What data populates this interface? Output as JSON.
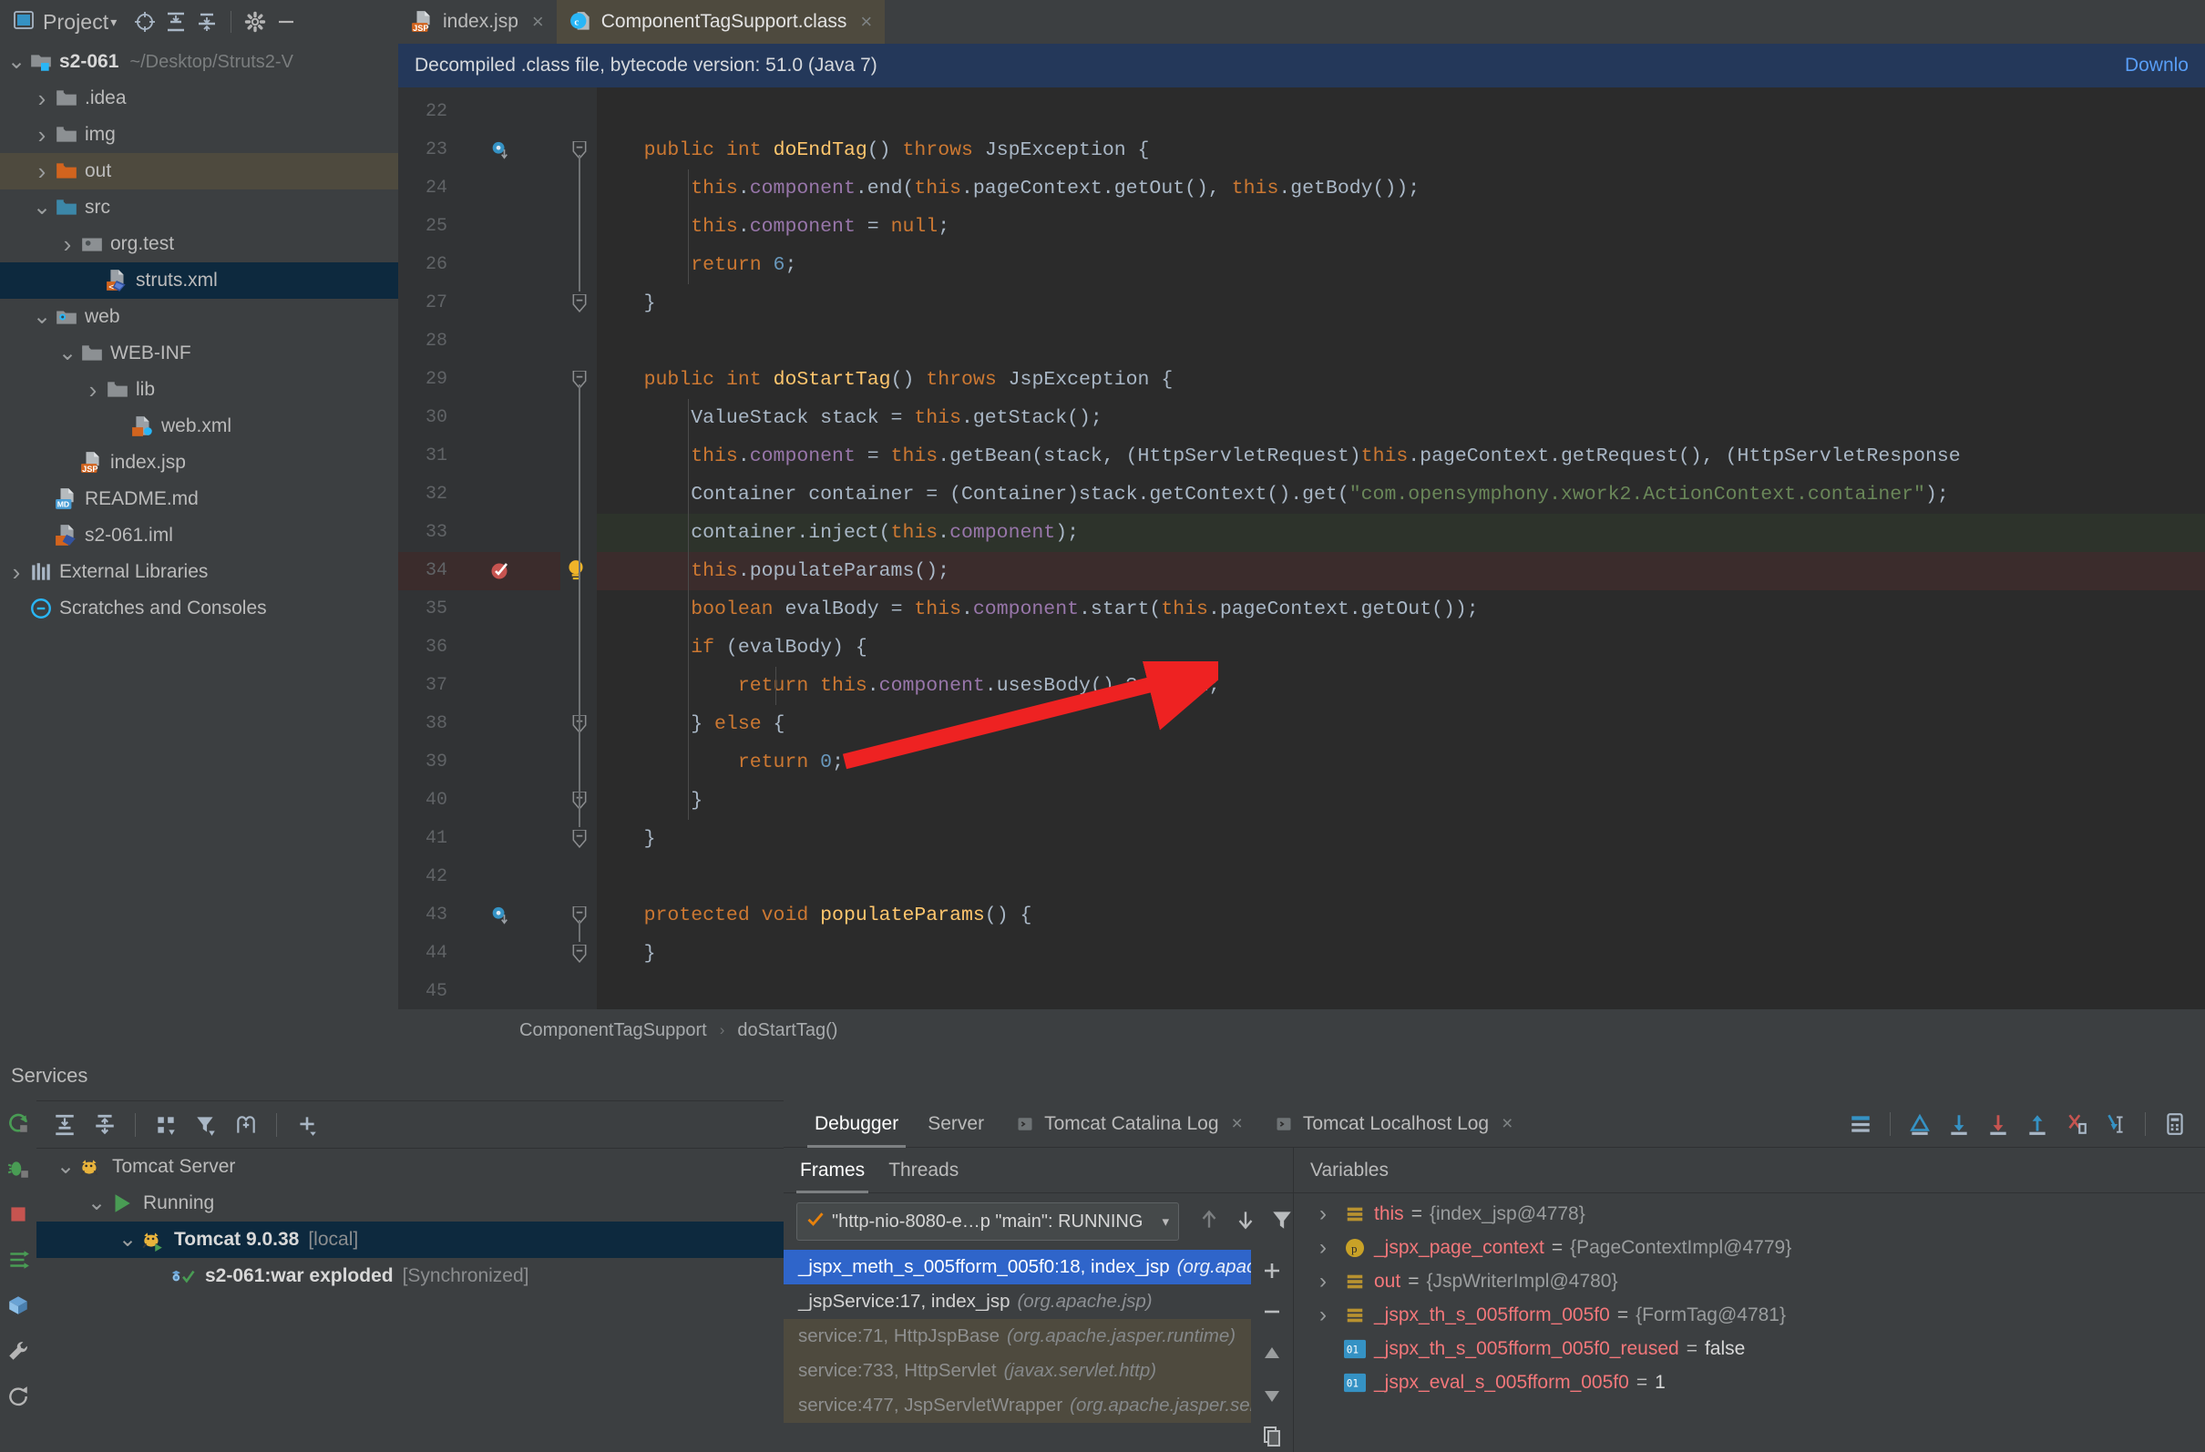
{
  "project_panel": {
    "title": "Project",
    "icons": [
      "project-view-icon",
      "locate-icon",
      "expand-all-icon",
      "collapse-all-icon",
      "settings-gear-icon",
      "hide-icon"
    ],
    "tree": [
      {
        "label": "s2-061",
        "path": "~/Desktop/Struts2-V",
        "icon": "module-folder-icon",
        "twisty": "v",
        "indent": 0,
        "bold": true,
        "state": "normal"
      },
      {
        "label": ".idea",
        "path": "",
        "icon": "folder-icon",
        "twisty": ">",
        "indent": 1,
        "bold": false,
        "state": "normal"
      },
      {
        "label": "img",
        "path": "",
        "icon": "folder-icon",
        "twisty": ">",
        "indent": 1,
        "bold": false,
        "state": "normal"
      },
      {
        "label": "out",
        "path": "",
        "icon": "folder-orange-icon",
        "twisty": ">",
        "indent": 1,
        "bold": false,
        "state": "brown"
      },
      {
        "label": "src",
        "path": "",
        "icon": "folder-blue-icon",
        "twisty": "v",
        "indent": 1,
        "bold": false,
        "state": "normal"
      },
      {
        "label": "org.test",
        "path": "",
        "icon": "package-icon",
        "twisty": ">",
        "indent": 2,
        "bold": false,
        "state": "normal"
      },
      {
        "label": "struts.xml",
        "path": "",
        "icon": "struts-xml-icon",
        "twisty": "",
        "indent": 3,
        "bold": false,
        "state": "blue"
      },
      {
        "label": "web",
        "path": "",
        "icon": "web-folder-icon",
        "twisty": "v",
        "indent": 1,
        "bold": false,
        "state": "normal"
      },
      {
        "label": "WEB-INF",
        "path": "",
        "icon": "folder-icon",
        "twisty": "v",
        "indent": 2,
        "bold": false,
        "state": "normal"
      },
      {
        "label": "lib",
        "path": "",
        "icon": "folder-icon",
        "twisty": ">",
        "indent": 3,
        "bold": false,
        "state": "normal"
      },
      {
        "label": "web.xml",
        "path": "",
        "icon": "web-xml-icon",
        "twisty": "",
        "indent": 4,
        "bold": false,
        "state": "normal"
      },
      {
        "label": "index.jsp",
        "path": "",
        "icon": "jsp-file-icon",
        "twisty": "",
        "indent": 2,
        "bold": false,
        "state": "normal"
      },
      {
        "label": "README.md",
        "path": "",
        "icon": "markdown-icon",
        "twisty": "",
        "indent": 1,
        "bold": false,
        "state": "normal"
      },
      {
        "label": "s2-061.iml",
        "path": "",
        "icon": "iml-file-icon",
        "twisty": "",
        "indent": 1,
        "bold": false,
        "state": "normal"
      },
      {
        "label": "External Libraries",
        "path": "",
        "icon": "libraries-icon",
        "twisty": ">",
        "indent": 0,
        "bold": false,
        "state": "normal"
      },
      {
        "label": "Scratches and Consoles",
        "path": "",
        "icon": "scratches-icon",
        "twisty": "",
        "indent": 0,
        "bold": false,
        "state": "normal"
      }
    ]
  },
  "editor_tabs": [
    {
      "label": "index.jsp",
      "icon": "jsp-file-icon",
      "active": false
    },
    {
      "label": "ComponentTagSupport.class",
      "icon": "class-file-icon",
      "active": true
    }
  ],
  "notification": {
    "message": "Decompiled .class file, bytecode version: 51.0 (Java 7)",
    "action": "Downlo"
  },
  "editor": {
    "first_line": 22,
    "last_line": 45,
    "highlight_line": 34,
    "lines": [
      {
        "n": 22,
        "tokens": []
      },
      {
        "n": 23,
        "tokens": [
          {
            "t": "    ",
            "c": "pln"
          },
          {
            "t": "public",
            "c": "kw"
          },
          {
            "t": " ",
            "c": "pln"
          },
          {
            "t": "int",
            "c": "kw"
          },
          {
            "t": " ",
            "c": "pln"
          },
          {
            "t": "doEndTag",
            "c": "met"
          },
          {
            "t": "() ",
            "c": "pln"
          },
          {
            "t": "throws",
            "c": "kw"
          },
          {
            "t": " JspException {",
            "c": "pln"
          }
        ]
      },
      {
        "n": 24,
        "tokens": [
          {
            "t": "        ",
            "c": "pln"
          },
          {
            "t": "this",
            "c": "kw"
          },
          {
            "t": ".",
            "c": "pln"
          },
          {
            "t": "component",
            "c": "fld"
          },
          {
            "t": ".end(",
            "c": "pln"
          },
          {
            "t": "this",
            "c": "kw"
          },
          {
            "t": ".pageContext.getOut(), ",
            "c": "pln"
          },
          {
            "t": "this",
            "c": "kw"
          },
          {
            "t": ".getBody());",
            "c": "pln"
          }
        ]
      },
      {
        "n": 25,
        "tokens": [
          {
            "t": "        ",
            "c": "pln"
          },
          {
            "t": "this",
            "c": "kw"
          },
          {
            "t": ".",
            "c": "pln"
          },
          {
            "t": "component",
            "c": "fld"
          },
          {
            "t": " = ",
            "c": "pln"
          },
          {
            "t": "null",
            "c": "kw"
          },
          {
            "t": ";",
            "c": "pln"
          }
        ]
      },
      {
        "n": 26,
        "tokens": [
          {
            "t": "        ",
            "c": "pln"
          },
          {
            "t": "return",
            "c": "kw"
          },
          {
            "t": " ",
            "c": "pln"
          },
          {
            "t": "6",
            "c": "num"
          },
          {
            "t": ";",
            "c": "pln"
          }
        ]
      },
      {
        "n": 27,
        "tokens": [
          {
            "t": "    }",
            "c": "pln"
          }
        ]
      },
      {
        "n": 28,
        "tokens": []
      },
      {
        "n": 29,
        "tokens": [
          {
            "t": "    ",
            "c": "pln"
          },
          {
            "t": "public",
            "c": "kw"
          },
          {
            "t": " ",
            "c": "pln"
          },
          {
            "t": "int",
            "c": "kw"
          },
          {
            "t": " ",
            "c": "pln"
          },
          {
            "t": "doStartTag",
            "c": "met"
          },
          {
            "t": "() ",
            "c": "pln"
          },
          {
            "t": "throws",
            "c": "kw"
          },
          {
            "t": " JspException {",
            "c": "pln"
          }
        ]
      },
      {
        "n": 30,
        "tokens": [
          {
            "t": "        ValueStack stack = ",
            "c": "pln"
          },
          {
            "t": "this",
            "c": "kw"
          },
          {
            "t": ".getStack();",
            "c": "pln"
          }
        ]
      },
      {
        "n": 31,
        "tokens": [
          {
            "t": "        ",
            "c": "pln"
          },
          {
            "t": "this",
            "c": "kw"
          },
          {
            "t": ".",
            "c": "pln"
          },
          {
            "t": "component",
            "c": "fld"
          },
          {
            "t": " = ",
            "c": "pln"
          },
          {
            "t": "this",
            "c": "kw"
          },
          {
            "t": ".getBean(stack, (HttpServletRequest)",
            "c": "pln"
          },
          {
            "t": "this",
            "c": "kw"
          },
          {
            "t": ".pageContext.getRequest(), (HttpServletResponse",
            "c": "pln"
          }
        ]
      },
      {
        "n": 32,
        "tokens": [
          {
            "t": "        Container container = (Container)stack.getContext().get(",
            "c": "pln"
          },
          {
            "t": "\"com.opensymphony.xwork2.ActionContext.container\"",
            "c": "str"
          },
          {
            "t": ");",
            "c": "pln"
          }
        ]
      },
      {
        "n": 33,
        "tokens": [
          {
            "t": "        container.inject(",
            "c": "pln"
          },
          {
            "t": "this",
            "c": "kw"
          },
          {
            "t": ".",
            "c": "pln"
          },
          {
            "t": "component",
            "c": "fld"
          },
          {
            "t": ");",
            "c": "pln"
          }
        ]
      },
      {
        "n": 34,
        "tokens": [
          {
            "t": "        ",
            "c": "pln"
          },
          {
            "t": "this",
            "c": "kw"
          },
          {
            "t": ".populateParams();",
            "c": "pln"
          }
        ]
      },
      {
        "n": 35,
        "tokens": [
          {
            "t": "        ",
            "c": "pln"
          },
          {
            "t": "boolean",
            "c": "kw"
          },
          {
            "t": " evalBody = ",
            "c": "pln"
          },
          {
            "t": "this",
            "c": "kw"
          },
          {
            "t": ".",
            "c": "pln"
          },
          {
            "t": "component",
            "c": "fld"
          },
          {
            "t": ".start(",
            "c": "pln"
          },
          {
            "t": "this",
            "c": "kw"
          },
          {
            "t": ".pageContext.getOut());",
            "c": "pln"
          }
        ]
      },
      {
        "n": 36,
        "tokens": [
          {
            "t": "        ",
            "c": "pln"
          },
          {
            "t": "if",
            "c": "kw"
          },
          {
            "t": " (evalBody) {",
            "c": "pln"
          }
        ]
      },
      {
        "n": 37,
        "tokens": [
          {
            "t": "            ",
            "c": "pln"
          },
          {
            "t": "return",
            "c": "kw"
          },
          {
            "t": " ",
            "c": "pln"
          },
          {
            "t": "this",
            "c": "kw"
          },
          {
            "t": ".",
            "c": "pln"
          },
          {
            "t": "component",
            "c": "fld"
          },
          {
            "t": ".usesBody() ? ",
            "c": "pln"
          },
          {
            "t": "2",
            "c": "num"
          },
          {
            "t": " : ",
            "c": "pln"
          },
          {
            "t": "1",
            "c": "num"
          },
          {
            "t": ";",
            "c": "pln"
          }
        ]
      },
      {
        "n": 38,
        "tokens": [
          {
            "t": "        } ",
            "c": "pln"
          },
          {
            "t": "else",
            "c": "kw"
          },
          {
            "t": " {",
            "c": "pln"
          }
        ]
      },
      {
        "n": 39,
        "tokens": [
          {
            "t": "            ",
            "c": "pln"
          },
          {
            "t": "return",
            "c": "kw"
          },
          {
            "t": " ",
            "c": "pln"
          },
          {
            "t": "0",
            "c": "num"
          },
          {
            "t": ";",
            "c": "pln"
          }
        ]
      },
      {
        "n": 40,
        "tokens": [
          {
            "t": "        }",
            "c": "pln"
          }
        ]
      },
      {
        "n": 41,
        "tokens": [
          {
            "t": "    }",
            "c": "pln"
          }
        ]
      },
      {
        "n": 42,
        "tokens": []
      },
      {
        "n": 43,
        "tokens": [
          {
            "t": "    ",
            "c": "pln"
          },
          {
            "t": "protected",
            "c": "kw"
          },
          {
            "t": " ",
            "c": "pln"
          },
          {
            "t": "void",
            "c": "kw"
          },
          {
            "t": " ",
            "c": "pln"
          },
          {
            "t": "populateParams",
            "c": "met"
          },
          {
            "t": "() {",
            "c": "pln"
          }
        ]
      },
      {
        "n": 44,
        "tokens": [
          {
            "t": "    }",
            "c": "pln"
          }
        ]
      },
      {
        "n": 45,
        "tokens": []
      }
    ]
  },
  "breadcrumb": {
    "class": "ComponentTagSupport",
    "sep": "›",
    "method": "doStartTag()"
  },
  "services": {
    "title": "Services",
    "toolbar_icons": [
      "expand-all-icon",
      "collapse-all-icon",
      "group-icon",
      "filter-icon",
      "add-tab-icon",
      "add-icon"
    ],
    "rail_icons": [
      "rerun-icon",
      "debug-icon",
      "stop-icon",
      "redeploy-icon",
      "deploy-icon",
      "settings-wrench-icon",
      "refresh-icon"
    ],
    "tree": [
      {
        "label": "Tomcat Server",
        "suffix": "",
        "icon": "tomcat-icon",
        "twisty": "v",
        "indent": 0,
        "bold": false,
        "selected": false
      },
      {
        "label": "Running",
        "suffix": "",
        "icon": "run-green-icon",
        "twisty": "v",
        "indent": 1,
        "bold": false,
        "selected": false
      },
      {
        "label": "Tomcat 9.0.38",
        "suffix": "[local]",
        "icon": "tomcat-run-icon",
        "twisty": "v",
        "indent": 2,
        "bold": true,
        "selected": true
      },
      {
        "label": "s2-061:war exploded",
        "suffix": "[Synchronized]",
        "icon": "artifact-ok-icon",
        "twisty": "",
        "indent": 3,
        "bold": true,
        "selected": false
      }
    ]
  },
  "debugger": {
    "tabs": [
      {
        "label": "Debugger",
        "icon": "",
        "closable": false,
        "active": true
      },
      {
        "label": "Server",
        "icon": "",
        "closable": false,
        "active": false
      },
      {
        "label": "Tomcat Catalina Log",
        "icon": "console-icon",
        "closable": true,
        "active": false
      },
      {
        "label": "Tomcat Localhost Log",
        "icon": "console-icon",
        "closable": true,
        "active": false
      }
    ],
    "toolbar_icons": [
      "layout-settings-icon",
      "show-execution-point-icon",
      "step-over-icon",
      "step-into-icon",
      "step-out-icon",
      "force-step-into-icon",
      "run-to-cursor-icon",
      "evaluate-expression-icon"
    ],
    "frames_panel": {
      "subtabs": [
        {
          "label": "Frames",
          "active": true
        },
        {
          "label": "Threads",
          "active": false
        }
      ],
      "thread_selector": {
        "value": "\"http-nio-8080-e…p \"main\": RUNNING",
        "status_icon": "check-orange-icon"
      },
      "nav_icons": [
        "up-arrow-icon",
        "down-arrow-icon",
        "filter-icon"
      ],
      "frames": [
        {
          "main": "_jspx_meth_s_005fform_005f0:18, index_jsp",
          "pkg": "(org.apache.js",
          "style": "selected"
        },
        {
          "main": "_jspService:17, index_jsp",
          "pkg": "(org.apache.jsp)",
          "style": "normal"
        },
        {
          "main": "service:71, HttpJspBase",
          "pkg": "(org.apache.jasper.runtime)",
          "style": "dim"
        },
        {
          "main": "service:733, HttpServlet",
          "pkg": "(javax.servlet.http)",
          "style": "dim"
        },
        {
          "main": "service:477, JspServletWrapper",
          "pkg": "(org.apache.jasper.servle",
          "style": "dim"
        }
      ],
      "scroll_icons": [
        "add-icon",
        "remove-icon",
        "up-icon",
        "down-icon",
        "copy-icon"
      ]
    },
    "variables_panel": {
      "title": "Variables",
      "rows": [
        {
          "twisty": ">",
          "icon": "object-list-icon",
          "name": "this",
          "value": "{index_jsp@4778}",
          "literal": false
        },
        {
          "twisty": ">",
          "icon": "param-icon",
          "name": "_jspx_page_context",
          "value": "{PageContextImpl@4779}",
          "literal": false
        },
        {
          "twisty": ">",
          "icon": "object-list-icon",
          "name": "out",
          "value": "{JspWriterImpl@4780}",
          "literal": false
        },
        {
          "twisty": ">",
          "icon": "object-list-icon",
          "name": "_jspx_th_s_005fform_005f0",
          "value": "{FormTag@4781}",
          "literal": false
        },
        {
          "twisty": "",
          "icon": "primitive-icon",
          "name": "_jspx_th_s_005fform_005f0_reused",
          "value": "false",
          "literal": true
        },
        {
          "twisty": "",
          "icon": "primitive-icon",
          "name": "_jspx_eval_s_005fform_005f0",
          "value": "1",
          "literal": true
        }
      ]
    }
  },
  "colors": {
    "bg_panel": "#3c3f41",
    "bg_editor": "#2b2b2b",
    "accent_blue": "#2f65ca",
    "notif_bg": "#24385a",
    "keyword": "#cc7832",
    "string": "#6a8759",
    "number": "#6897bb",
    "field": "#9876aa",
    "method": "#ffc66d",
    "plain": "#a9b7c6",
    "var_name": "#f2777a",
    "arrow": "#ee2222"
  }
}
